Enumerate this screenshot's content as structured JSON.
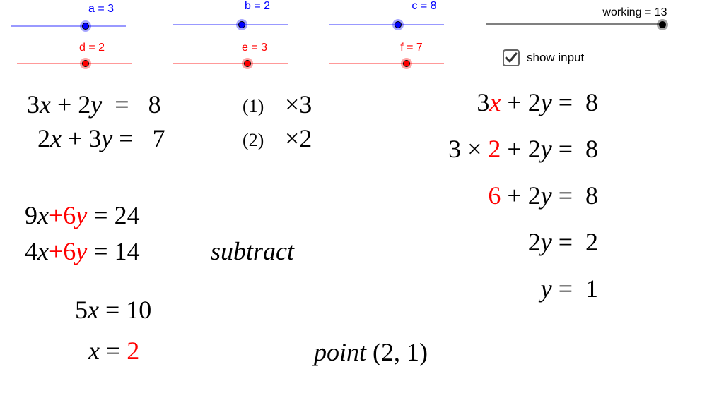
{
  "sliders": [
    {
      "name": "a",
      "label": "a = 3",
      "value": 3,
      "color": "#0000ff"
    },
    {
      "name": "b",
      "label": "b = 2",
      "value": 2,
      "color": "#0000ff"
    },
    {
      "name": "c",
      "label": "c = 8",
      "value": 8,
      "color": "#0000ff"
    },
    {
      "name": "d",
      "label": "d = 2",
      "value": 2,
      "color": "#ff0000"
    },
    {
      "name": "e",
      "label": "e = 3",
      "value": 3,
      "color": "#ff0000"
    },
    {
      "name": "f",
      "label": "f = 7",
      "value": 7,
      "color": "#ff0000"
    },
    {
      "name": "working",
      "label": "working = 13",
      "value": 13,
      "color": "#000000"
    }
  ],
  "checkbox": {
    "label": "show input",
    "checked": true
  },
  "system": {
    "eq1": {
      "lhs_a": "3",
      "lhs_b": "2",
      "rhs": "8",
      "tag": "(1)",
      "multiplier": "×3"
    },
    "eq2": {
      "lhs_a": "2",
      "lhs_b": "3",
      "rhs": "7",
      "tag": "(2)",
      "multiplier": "×2"
    }
  },
  "scaled": {
    "eq1": {
      "x_coef": "9",
      "y_term": "+6",
      "rhs": "24"
    },
    "eq2": {
      "x_coef": "4",
      "y_term": "+6",
      "rhs": "14"
    },
    "operation": "subtract"
  },
  "result": {
    "combined": {
      "x_coef": "5",
      "rhs": "10"
    },
    "x_value": "2"
  },
  "point": {
    "word": "point",
    "coords": "(2, 1)"
  },
  "substitution": {
    "line1": {
      "coef": "3",
      "rhs": "8"
    },
    "line2": {
      "coef": "3",
      "times": "×",
      "x_value": "2",
      "rhs": "8"
    },
    "line3": {
      "product": "6",
      "rhs": "8"
    },
    "line4": {
      "coef": "2",
      "rhs": "2"
    },
    "line5": {
      "rhs": "1"
    }
  },
  "colors": {
    "accent_red": "#ff0000",
    "accent_blue": "#0000ff"
  }
}
